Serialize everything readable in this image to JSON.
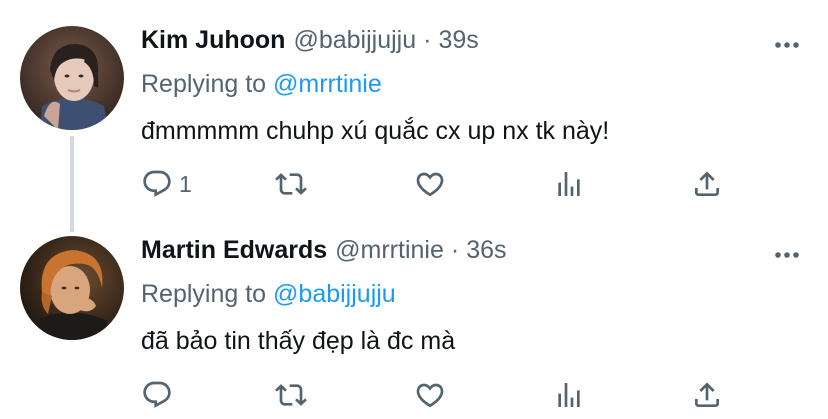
{
  "tweets": [
    {
      "display_name": "Kim Juhoon",
      "handle": "@babijjujju",
      "separator": "·",
      "time": "39s",
      "replying_prefix": "Replying to",
      "replying_to": "@mrrtinie",
      "text": "đmmmmm chuhp xú quắc cx up nx tk này!",
      "reply_count": "1",
      "icons": [
        "reply-icon",
        "retweet-icon",
        "like-icon",
        "analytics-icon",
        "share-icon",
        "more-icon"
      ]
    },
    {
      "display_name": "Martin Edwards",
      "handle": "@mrrtinie",
      "separator": "·",
      "time": "36s",
      "replying_prefix": "Replying to",
      "replying_to": "@babijjujju",
      "text": "đã bảo tin thấy đẹp là đc mà",
      "reply_count": "",
      "icons": [
        "reply-icon",
        "retweet-icon",
        "like-icon",
        "analytics-icon",
        "share-icon",
        "more-icon"
      ]
    }
  ],
  "colors": {
    "text_primary": "#0f1419",
    "text_secondary": "#536471",
    "link": "#1d9bf0",
    "thread_line": "#cfd9de"
  }
}
